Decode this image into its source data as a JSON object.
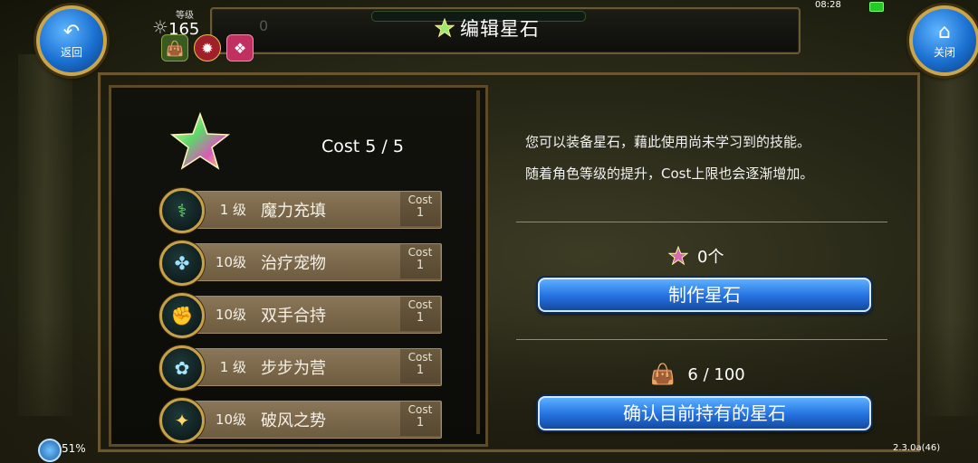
{
  "header": {
    "title": "编辑星石",
    "level_label": "等级",
    "level_value": "165",
    "secondary_value": "0",
    "time": "08:28"
  },
  "nav": {
    "back_label": "返回",
    "close_label": "关闭"
  },
  "cost": {
    "text": "Cost 5 / 5"
  },
  "skills": [
    {
      "level": "1 级",
      "name": "魔力充填",
      "cost_label": "Cost",
      "cost_value": "1"
    },
    {
      "level": "10级",
      "name": "治疗宠物",
      "cost_label": "Cost",
      "cost_value": "1"
    },
    {
      "level": "10级",
      "name": "双手合持",
      "cost_label": "Cost",
      "cost_value": "1"
    },
    {
      "level": "1 级",
      "name": "步步为营",
      "cost_label": "Cost",
      "cost_value": "1"
    },
    {
      "level": "10级",
      "name": "破风之势",
      "cost_label": "Cost",
      "cost_value": "1"
    }
  ],
  "description": {
    "line1": "您可以装备星石，藉此使用尚未学习到的技能。",
    "line2": "随着角色等级的提升，Cost上限也会逐渐增加。"
  },
  "stones": {
    "count_text": "0个",
    "craft_button": "制作星石"
  },
  "inventory": {
    "count_text": "6 / 100",
    "confirm_button": "确认目前持有的星石"
  },
  "footer": {
    "battery": "51%",
    "version": "2.3.0a(46)"
  },
  "colors": {
    "button_blue": "#2470e0",
    "frame_gold": "#c9a45a",
    "skill_row": "#8a7658"
  }
}
